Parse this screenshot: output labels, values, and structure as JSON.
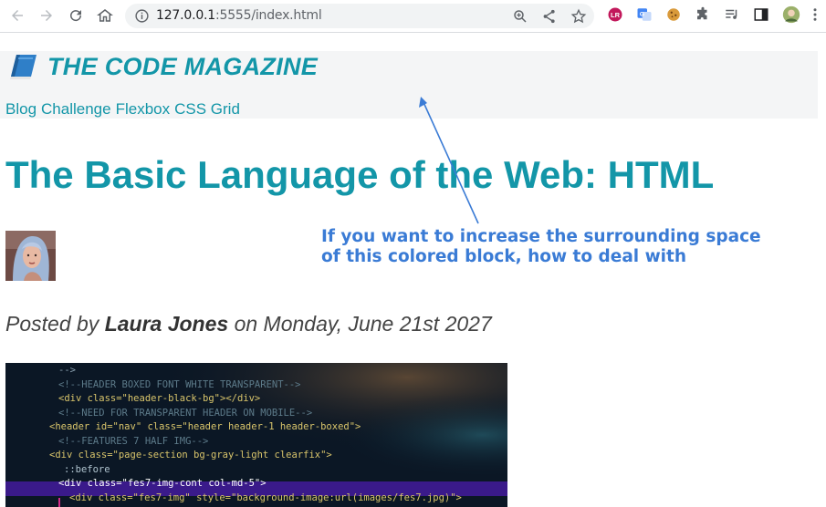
{
  "browser": {
    "url_host": "127.0.0.1",
    "url_rest": ":5555/index.html"
  },
  "site": {
    "title": "THE CODE MAGAZINE",
    "nav": [
      "Blog",
      "Challenge",
      "Flexbox",
      "CSS Grid"
    ]
  },
  "article": {
    "headline": "The Basic Language of the Web: HTML",
    "byline_prefix": "Posted by ",
    "author": "Laura Jones",
    "byline_suffix": " on Monday, June 21st 2027"
  },
  "annotation": {
    "line1": "If you want to increase the surrounding space",
    "line2": "of this colored block, how to deal with",
    "color": "#3a7bd5"
  },
  "code_image_lines": [
    {
      "text": "-->",
      "color": "#8aa0b0"
    },
    {
      "text": "<!--HEADER BOXED FONT WHITE TRANSPARENT-->",
      "color": "#5d7b8a"
    },
    {
      "text": "<div class=\"header-black-bg\"></div>",
      "color": "#d9c56b"
    },
    {
      "text": "<!--NEED FOR TRANSPARENT HEADER ON MOBILE-->",
      "color": "#5d7b8a"
    },
    {
      "text": "<header id=\"nav\" class=\"header header-1 header-boxed\">",
      "color": "#d9c56b"
    },
    {
      "text": "<!--FEATURES 7 HALF IMG-->",
      "color": "#5d7b8a"
    },
    {
      "text": "<div class=\"page-section bg-gray-light clearfix\">",
      "color": "#d9c56b"
    },
    {
      "text": "::before",
      "color": "#b0c4cf"
    },
    {
      "text": "<div class=\"fes7-img-cont col-md-5\">",
      "color": "#ffffff"
    },
    {
      "text": "<div class=\"fes7-img\" style=\"background-image:url(images/fes7.jpg)\">",
      "color": "#d9c56b"
    }
  ]
}
